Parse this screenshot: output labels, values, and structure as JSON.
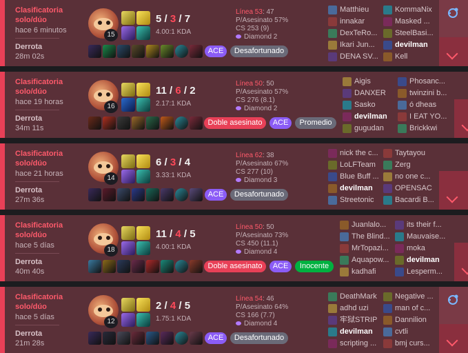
{
  "matches": [
    {
      "queue": "Clasificatoria solo/dúo",
      "ago": "hace 6 minutos",
      "result": "Derrota",
      "duration": "28m 02s",
      "level": "15",
      "kills": "5",
      "deaths": "3",
      "assists": "7",
      "kda_ratio": "4.00:1 KDA",
      "line_label": "Línea 53",
      "line_value": ": 47",
      "kill_part": "P/Asesinato 57%",
      "cs": "CS 253 (9)",
      "rank": "Diamond 2",
      "badges": [
        "ACE",
        "Desafortunado"
      ],
      "team1": [
        "Matthieu",
        "innakar",
        "DexTeRo...",
        "Ikari Jun...",
        "DENA SV..."
      ],
      "team2": [
        "KommaNix",
        "Masked ...",
        "SteelBasi...",
        "devilman",
        "Kell"
      ],
      "team_me": "team2",
      "me_index": 3
    },
    {
      "queue": "Clasificatoria solo/dúo",
      "ago": "hace 19 horas",
      "result": "Derrota",
      "duration": "34m 11s",
      "level": "16",
      "kills": "11",
      "deaths": "6",
      "assists": "2",
      "kda_ratio": "2.17:1 KDA",
      "line_label": "Línea 50",
      "line_value": ": 50",
      "kill_part": "P/Asesinato 57%",
      "cs": "CS 276 (8.1)",
      "rank": "Diamond 2",
      "badges": [
        "Doble asesinato",
        "ACE",
        "Promedio"
      ],
      "team1": [
        "Aigis",
        "DANXER",
        "Sasko",
        "devilman",
        "gugudan"
      ],
      "team2": [
        "Phosanc...",
        "twinzini b...",
        "ó dheas",
        "I EAT YO...",
        "Brickkwi"
      ],
      "team_me": "team1",
      "me_index": 3
    },
    {
      "queue": "Clasificatoria solo/dúo",
      "ago": "hace 21 horas",
      "result": "Derrota",
      "duration": "27m 36s",
      "level": "14",
      "kills": "6",
      "deaths": "3",
      "assists": "4",
      "kda_ratio": "3.33:1 KDA",
      "line_label": "Línea 62",
      "line_value": ": 38",
      "kill_part": "P/Asesinato 67%",
      "cs": "CS 277 (10)",
      "rank": "Diamond 3",
      "badges": [
        "ACE",
        "Desafortunado"
      ],
      "team1": [
        "nick the c...",
        "LoLFTeam",
        "Blue Buff ...",
        "devilman",
        "Streetonic"
      ],
      "team2": [
        "Taytayou",
        "Zerg",
        "no one c...",
        "OPENSAC",
        "Bacardi B..."
      ],
      "team_me": "team1",
      "me_index": 3
    },
    {
      "queue": "Clasificatoria solo/dúo",
      "ago": "hace 5 días",
      "result": "Derrota",
      "duration": "40m 40s",
      "level": "18",
      "kills": "11",
      "deaths": "4",
      "assists": "5",
      "kda_ratio": "4.00:1 KDA",
      "line_label": "Línea 50",
      "line_value": ": 50",
      "kill_part": "P/Asesinato 73%",
      "cs": "CS 450 (11.1)",
      "rank": "Diamond 4",
      "badges": [
        "Doble asesinato",
        "ACE",
        "Inocente"
      ],
      "team1": [
        "Juanlalo...",
        "The Blind...",
        "MrTopazi...",
        "Aquapow...",
        "kadhafi"
      ],
      "team2": [
        "its their f...",
        "Mauvaise...",
        "moka",
        "devilman",
        "Lesperm..."
      ],
      "team_me": "team2",
      "me_index": 3
    },
    {
      "queue": "Clasificatoria solo/dúo",
      "ago": "hace 5 días",
      "result": "Derrota",
      "duration": "21m 28s",
      "level": "12",
      "kills": "2",
      "deaths": "4",
      "assists": "5",
      "kda_ratio": "1.75:1 KDA",
      "line_label": "Línea 54",
      "line_value": ": 46",
      "kill_part": "P/Asesinato 64%",
      "cs": "CS 166 (7.7)",
      "rank": "Diamond 4",
      "badges": [
        "ACE",
        "Desafortunado"
      ],
      "team1": [
        "DeathMark",
        "adhd uzi",
        "牢狱STRIP",
        "devilman",
        "scripting ..."
      ],
      "team2": [
        "Negative ...",
        "man of c...",
        "Dannilion",
        "cvtli",
        "bmj curs..."
      ],
      "team_me": "team1",
      "me_index": 3
    }
  ],
  "colors": {
    "loss_bar": "#e84057",
    "card_bg": "#5a3038",
    "kill_red": "#ff4a5a",
    "ace": "#8b5cf6",
    "double_kill": "#e84057",
    "innocent": "#00b140"
  },
  "icons": {
    "expand": "chevron-down-icon",
    "share": "share-icon",
    "rank": "diamond-rank-icon"
  }
}
